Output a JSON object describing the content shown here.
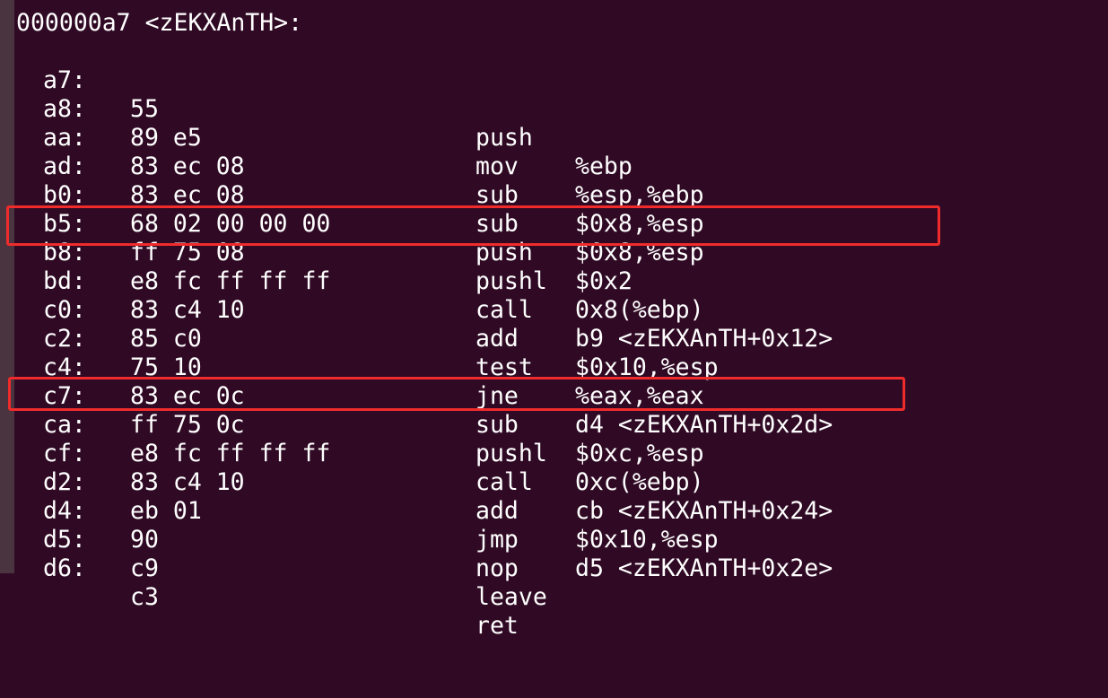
{
  "function_header": "000000a7 <zEKXAnTH>:",
  "instructions": [
    {
      "addr": "a7:",
      "bytes": "55",
      "mnemonic": "push",
      "operands": "%ebp"
    },
    {
      "addr": "a8:",
      "bytes": "89 e5",
      "mnemonic": "mov",
      "operands": "%esp,%ebp"
    },
    {
      "addr": "aa:",
      "bytes": "83 ec 08",
      "mnemonic": "sub",
      "operands": "$0x8,%esp"
    },
    {
      "addr": "ad:",
      "bytes": "83 ec 08",
      "mnemonic": "sub",
      "operands": "$0x8,%esp"
    },
    {
      "addr": "b0:",
      "bytes": "68 02 00 00 00",
      "mnemonic": "push",
      "operands": "$0x2"
    },
    {
      "addr": "b5:",
      "bytes": "ff 75 08",
      "mnemonic": "pushl",
      "operands": "0x8(%ebp)"
    },
    {
      "addr": "b8:",
      "bytes": "e8 fc ff ff ff",
      "mnemonic": "call",
      "operands": "b9 <zEKXAnTH+0x12>"
    },
    {
      "addr": "bd:",
      "bytes": "83 c4 10",
      "mnemonic": "add",
      "operands": "$0x10,%esp"
    },
    {
      "addr": "c0:",
      "bytes": "85 c0",
      "mnemonic": "test",
      "operands": "%eax,%eax"
    },
    {
      "addr": "c2:",
      "bytes": "75 10",
      "mnemonic": "jne",
      "operands": "d4 <zEKXAnTH+0x2d>"
    },
    {
      "addr": "c4:",
      "bytes": "83 ec 0c",
      "mnemonic": "sub",
      "operands": "$0xc,%esp"
    },
    {
      "addr": "c7:",
      "bytes": "ff 75 0c",
      "mnemonic": "pushl",
      "operands": "0xc(%ebp)"
    },
    {
      "addr": "ca:",
      "bytes": "e8 fc ff ff ff",
      "mnemonic": "call",
      "operands": "cb <zEKXAnTH+0x24>"
    },
    {
      "addr": "cf:",
      "bytes": "83 c4 10",
      "mnemonic": "add",
      "operands": "$0x10,%esp"
    },
    {
      "addr": "d2:",
      "bytes": "eb 01",
      "mnemonic": "jmp",
      "operands": "d5 <zEKXAnTH+0x2e>"
    },
    {
      "addr": "d4:",
      "bytes": "90",
      "mnemonic": "nop",
      "operands": ""
    },
    {
      "addr": "d5:",
      "bytes": "c9",
      "mnemonic": "leave",
      "operands": ""
    },
    {
      "addr": "d6:",
      "bytes": "c3",
      "mnemonic": "ret",
      "operands": ""
    }
  ],
  "highlighted_addresses": [
    "b8:",
    "ca:"
  ],
  "colors": {
    "background": "#300a24",
    "text": "#ffffff",
    "highlight_border": "#ef2b2b"
  }
}
